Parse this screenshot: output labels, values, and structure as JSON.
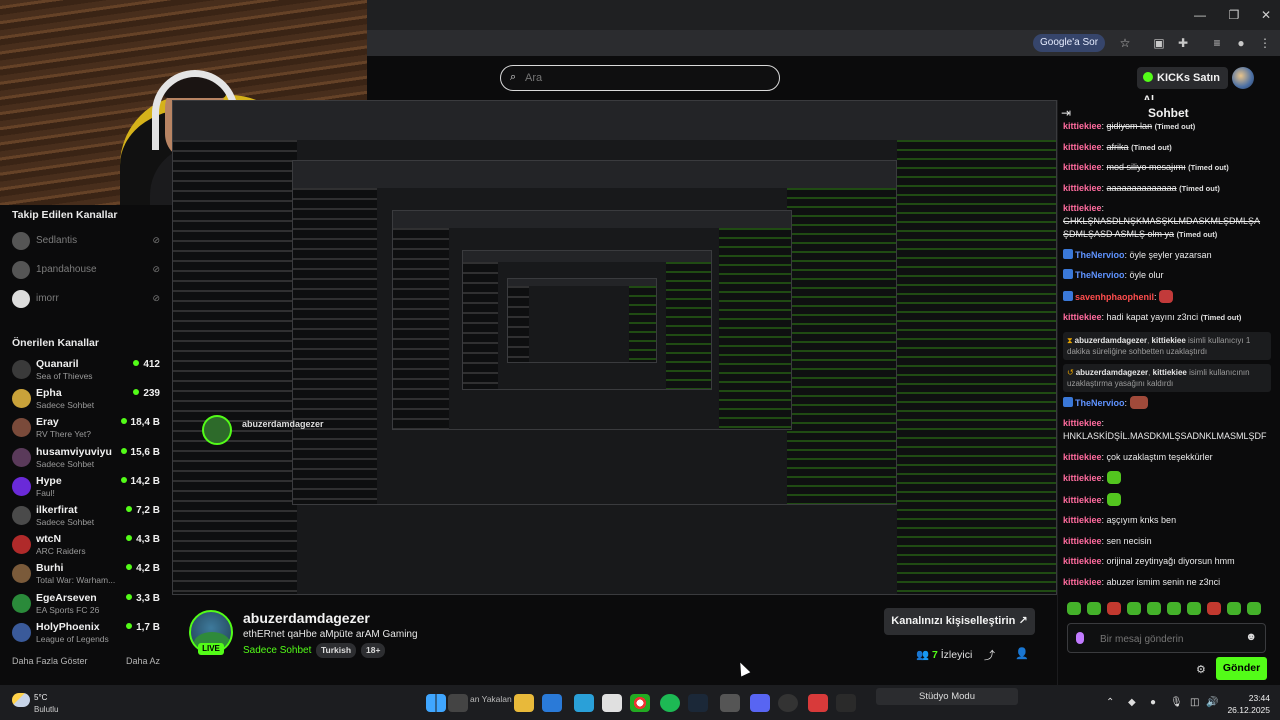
{
  "browser": {
    "google_sor": "Google'a Sor"
  },
  "header": {
    "search_placeholder": "Ara",
    "kicks_label": "KICKs Satın Al"
  },
  "sidebar": {
    "followed_title": "Takip Edilen Kanallar",
    "followed": [
      {
        "name": "Sedlantis"
      },
      {
        "name": "1pandahouse"
      },
      {
        "name": "imorr"
      }
    ],
    "recommended_title": "Önerilen Kanallar",
    "recommended": [
      {
        "name": "Quanaril",
        "category": "Sea of Thieves",
        "viewers": "412",
        "color": "#3a3a3a"
      },
      {
        "name": "Epha",
        "category": "Sadece Sohbet",
        "viewers": "239",
        "color": "#c9a23a"
      },
      {
        "name": "Eray",
        "category": "RV There Yet?",
        "viewers": "18,4 B",
        "color": "#7a4a3a"
      },
      {
        "name": "husamviyuviyu",
        "category": "Sadece Sohbet",
        "viewers": "15,6 B",
        "color": "#5a3a5a"
      },
      {
        "name": "Hype",
        "category": "Faul!",
        "viewers": "14,2 B",
        "color": "#6a2ad8"
      },
      {
        "name": "ilkerfirat",
        "category": "Sadece Sohbet",
        "viewers": "7,2 B",
        "color": "#4a4a4a"
      },
      {
        "name": "wtcN",
        "category": "ARC Raiders",
        "viewers": "4,3 B",
        "color": "#b02a2a"
      },
      {
        "name": "Burhi",
        "category": "Total War: Warham...",
        "viewers": "4,2 B",
        "color": "#7a5a3a"
      },
      {
        "name": "EgeArseven",
        "category": "EA Sports FC 26",
        "viewers": "3,3 B",
        "color": "#2a8a3a"
      },
      {
        "name": "HolyPhoenix",
        "category": "League of Legends",
        "viewers": "1,7 B",
        "color": "#3a5a9a"
      }
    ],
    "show_more": "Daha Fazla Göster",
    "collapse": "Daha Az"
  },
  "stream": {
    "mirror_name": "abuzerdamdagezer",
    "studio_mode": "Stüdyo Modu"
  },
  "channel": {
    "name": "abuzerdamdagezer",
    "title": "ethERnet qaHbe aMpüte arAM Gaming",
    "category": "Sadece Sohbet",
    "tags": [
      "Turkish",
      "18+"
    ],
    "live": "LIVE",
    "personalize": "Kanalınızı kişiselleştirin",
    "viewers_count": "7",
    "viewers_label": "İzleyici"
  },
  "chat": {
    "title": "Sohbet",
    "messages": [
      {
        "user": "kittiekiee",
        "text": "gidiyom lan",
        "strike": true,
        "timeout": "(Timed out)"
      },
      {
        "user": "kittiekiee",
        "text": "afrika",
        "strike": true,
        "timeout": "(Timed out)"
      },
      {
        "user": "kittiekiee",
        "text": "mod siliyo mesajımı",
        "strike": true,
        "timeout": "(Timed out)"
      },
      {
        "user": "kittiekiee",
        "text": "aaaaaaaaaaaaaa",
        "strike": true,
        "timeout": "(Timed out)"
      },
      {
        "user": "kittiekiee",
        "text": "GHKLŞNASDLNŞKMASŞKLMDASKMLŞDMLŞA ŞDMLŞASD ASMLŞ olm ya",
        "strike": true,
        "timeout": "(Timed out)"
      },
      {
        "user": "TheNervioo",
        "text": "öyle şeyler yazarsan",
        "kick": true
      },
      {
        "user": "TheNervioo",
        "text": "öyle olur",
        "kick": true
      },
      {
        "user": "savenhphaophenil",
        "text": "",
        "kick": true,
        "emote": "red"
      }
    ],
    "last_pre": {
      "user": "kittiekiee",
      "text": "hadi kapat yayını z3nci",
      "timeout": "(Timed out)"
    },
    "sys1": {
      "mod": "abuzerdamdagezer",
      "target": "kittiekiee",
      "text": "isimli kullanıcıyı 1 dakika süreliğine sohbetten uzaklaştırdı"
    },
    "sys2": {
      "mod": "abuzerdamdagezer",
      "target": "kittiekiee",
      "text": "isimli kullanıcının uzaklaştırma yasağını kaldırdı"
    },
    "after": [
      {
        "user": "TheNervioo",
        "text": "",
        "kick": true,
        "emote": "pic"
      },
      {
        "user": "kittiekiee",
        "text": "HNKLASKİDŞİL.MASDKMLŞSADNKLMASMLŞDF"
      },
      {
        "user": "kittiekiee",
        "text": "çok uzaklaştım teşekkürler"
      },
      {
        "user": "kittiekiee",
        "text": "",
        "emote": "green"
      },
      {
        "user": "kittiekiee",
        "text": "",
        "emote": "green"
      },
      {
        "user": "kittiekiee",
        "text": "aşçıyım knks ben"
      },
      {
        "user": "kittiekiee",
        "text": "sen necisin"
      },
      {
        "user": "kittiekiee",
        "text": "orijinal zeytinyağı diyorsun hmm"
      },
      {
        "user": "kittiekiee",
        "text": "abuzer ismim senin ne z3nci"
      }
    ],
    "input_placeholder": "Bir mesaj gönderin",
    "send": "Gönder"
  },
  "taskbar": {
    "temp": "5°C",
    "weather": "Bulutlu",
    "ghost_text": "an Yakalan",
    "time": "23:44",
    "date": "26.12.2025"
  },
  "colors": {
    "accent": "#53fc18",
    "username": "#ff6b9e",
    "username_blue": "#5f93ff"
  }
}
